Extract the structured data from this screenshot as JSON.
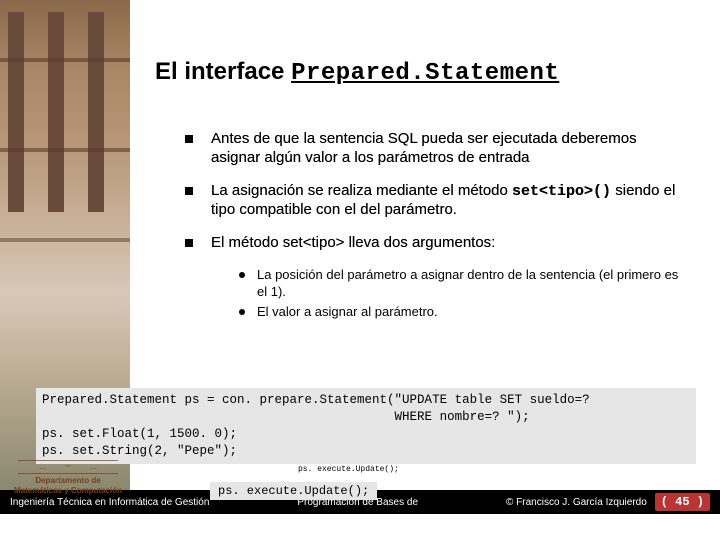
{
  "title": {
    "prefix": "El interface ",
    "code": "Prepared.Statement"
  },
  "bullets": [
    {
      "text": "Antes de que la sentencia SQL pueda ser ejecutada deberemos asignar algún valor a los parámetros de entrada"
    },
    {
      "pre": "La asignación se realiza mediante el método ",
      "code": "set<tipo>()",
      "post": " siendo el tipo compatible con el del parámetro."
    },
    {
      "text": "El método set<tipo> lleva dos argumentos:"
    }
  ],
  "subbullets": [
    "La posición del parámetro a asignar dentro de la sentencia (el primero es el 1).",
    "El valor a asignar al parámetro."
  ],
  "code_block": "Prepared.Statement ps = con. prepare.Statement(\"UPDATE table SET sueldo=?\n                                               WHERE nombre=? \");\nps. set.Float(1, 1500. 0);\nps. set.String(2, \"Pepe\");",
  "code_small": "ps. execute.Update();",
  "code_exec": "ps. execute.Update();",
  "dept": {
    "l1": "Departamento de",
    "l2": "Matemáticas y Computación"
  },
  "footer": {
    "left": "Ingeniería Técnica en Informática de Gestión",
    "center": "Programación de Bases de",
    "right": "© Francisco J. García Izquierdo",
    "page": "( 45 )"
  }
}
